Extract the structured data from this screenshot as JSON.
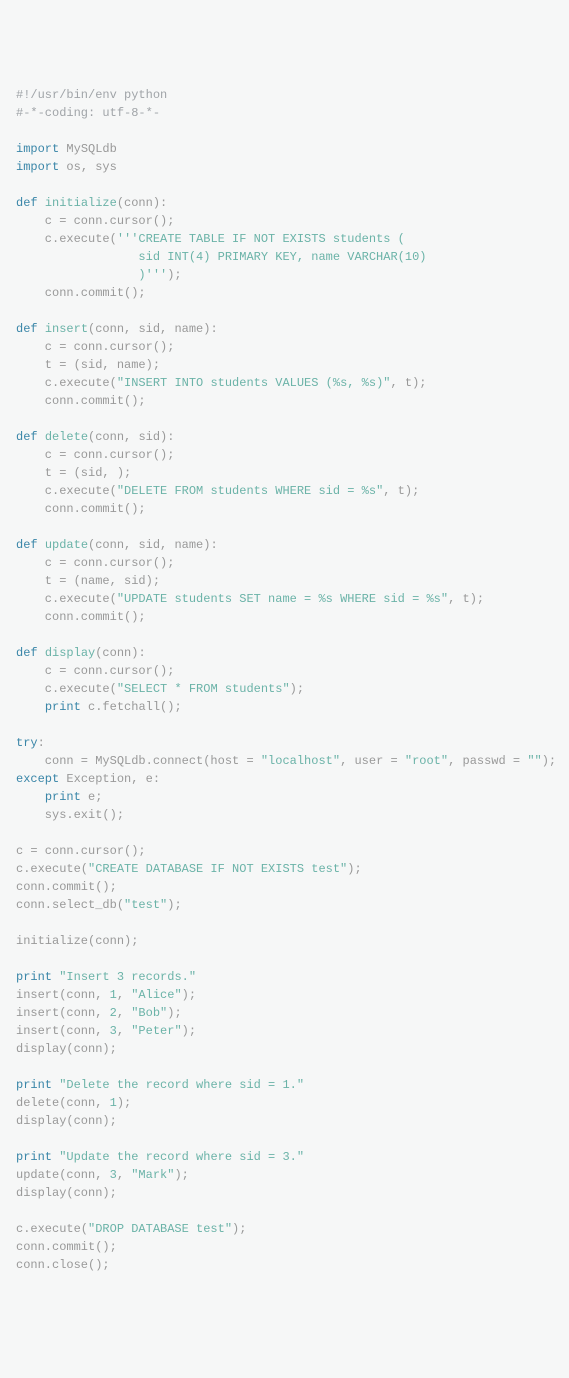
{
  "code": {
    "lines": [
      [
        [
          "com",
          "#!/usr/bin/env python"
        ]
      ],
      [
        [
          "com",
          "#-*-coding: utf-8-*-"
        ]
      ],
      [],
      [
        [
          "kw",
          "import"
        ],
        [
          "id",
          " MySQLdb"
        ]
      ],
      [
        [
          "kw",
          "import"
        ],
        [
          "id",
          " os, sys"
        ]
      ],
      [],
      [
        [
          "kw",
          "def"
        ],
        [
          "id",
          " "
        ],
        [
          "fn",
          "initialize"
        ],
        [
          "id",
          "(conn):"
        ]
      ],
      [
        [
          "id",
          "    c = conn.cursor();"
        ]
      ],
      [
        [
          "id",
          "    c.execute("
        ],
        [
          "str",
          "'''CREATE TABLE IF NOT EXISTS students ("
        ]
      ],
      [
        [
          "str",
          "                 sid INT(4) PRIMARY KEY, name VARCHAR(10)"
        ]
      ],
      [
        [
          "str",
          "                 )'''"
        ],
        [
          "id",
          ");"
        ]
      ],
      [
        [
          "id",
          "    conn.commit();"
        ]
      ],
      [],
      [
        [
          "kw",
          "def"
        ],
        [
          "id",
          " "
        ],
        [
          "fn",
          "insert"
        ],
        [
          "id",
          "(conn, sid, name):"
        ]
      ],
      [
        [
          "id",
          "    c = conn.cursor();"
        ]
      ],
      [
        [
          "id",
          "    t = (sid, name);"
        ]
      ],
      [
        [
          "id",
          "    c.execute("
        ],
        [
          "str",
          "\"INSERT INTO students VALUES (%s, %s)\""
        ],
        [
          "id",
          ", t);"
        ]
      ],
      [
        [
          "id",
          "    conn.commit();"
        ]
      ],
      [],
      [
        [
          "kw",
          "def"
        ],
        [
          "id",
          " "
        ],
        [
          "fn",
          "delete"
        ],
        [
          "id",
          "(conn, sid):"
        ]
      ],
      [
        [
          "id",
          "    c = conn.cursor();"
        ]
      ],
      [
        [
          "id",
          "    t = (sid, );"
        ]
      ],
      [
        [
          "id",
          "    c.execute("
        ],
        [
          "str",
          "\"DELETE FROM students WHERE sid = %s\""
        ],
        [
          "id",
          ", t);"
        ]
      ],
      [
        [
          "id",
          "    conn.commit();"
        ]
      ],
      [],
      [
        [
          "kw",
          "def"
        ],
        [
          "id",
          " "
        ],
        [
          "fn",
          "update"
        ],
        [
          "id",
          "(conn, sid, name):"
        ]
      ],
      [
        [
          "id",
          "    c = conn.cursor();"
        ]
      ],
      [
        [
          "id",
          "    t = (name, sid);"
        ]
      ],
      [
        [
          "id",
          "    c.execute("
        ],
        [
          "str",
          "\"UPDATE students SET name = %s WHERE sid = %s\""
        ],
        [
          "id",
          ", t);"
        ]
      ],
      [
        [
          "id",
          "    conn.commit();"
        ]
      ],
      [],
      [
        [
          "kw",
          "def"
        ],
        [
          "id",
          " "
        ],
        [
          "fn",
          "display"
        ],
        [
          "id",
          "(conn):"
        ]
      ],
      [
        [
          "id",
          "    c = conn.cursor();"
        ]
      ],
      [
        [
          "id",
          "    c.execute("
        ],
        [
          "str",
          "\"SELECT * FROM students\""
        ],
        [
          "id",
          ");"
        ]
      ],
      [
        [
          "id",
          "    "
        ],
        [
          "kw",
          "print"
        ],
        [
          "id",
          " c.fetchall();"
        ]
      ],
      [],
      [
        [
          "kw",
          "try"
        ],
        [
          "id",
          ":"
        ]
      ],
      [
        [
          "id",
          "    conn = MySQLdb.connect(host = "
        ],
        [
          "str",
          "\"localhost\""
        ],
        [
          "id",
          ", user = "
        ],
        [
          "str",
          "\"root\""
        ],
        [
          "id",
          ", passwd = "
        ],
        [
          "str",
          "\"\""
        ],
        [
          "id",
          ");"
        ]
      ],
      [
        [
          "kw",
          "except"
        ],
        [
          "id",
          " Exception, e:"
        ]
      ],
      [
        [
          "id",
          "    "
        ],
        [
          "kw",
          "print"
        ],
        [
          "id",
          " e;"
        ]
      ],
      [
        [
          "id",
          "    sys.exit();"
        ]
      ],
      [],
      [
        [
          "id",
          "c = conn.cursor();"
        ]
      ],
      [
        [
          "id",
          "c.execute("
        ],
        [
          "str",
          "\"CREATE DATABASE IF NOT EXISTS test\""
        ],
        [
          "id",
          ");"
        ]
      ],
      [
        [
          "id",
          "conn.commit();"
        ]
      ],
      [
        [
          "id",
          "conn.select_db("
        ],
        [
          "str",
          "\"test\""
        ],
        [
          "id",
          ");"
        ]
      ],
      [],
      [
        [
          "id",
          "initialize(conn);"
        ]
      ],
      [],
      [
        [
          "kw",
          "print"
        ],
        [
          "id",
          " "
        ],
        [
          "str",
          "\"Insert 3 records.\""
        ]
      ],
      [
        [
          "id",
          "insert(conn, "
        ],
        [
          "num",
          "1"
        ],
        [
          "id",
          ", "
        ],
        [
          "str",
          "\"Alice\""
        ],
        [
          "id",
          ");"
        ]
      ],
      [
        [
          "id",
          "insert(conn, "
        ],
        [
          "num",
          "2"
        ],
        [
          "id",
          ", "
        ],
        [
          "str",
          "\"Bob\""
        ],
        [
          "id",
          ");"
        ]
      ],
      [
        [
          "id",
          "insert(conn, "
        ],
        [
          "num",
          "3"
        ],
        [
          "id",
          ", "
        ],
        [
          "str",
          "\"Peter\""
        ],
        [
          "id",
          ");"
        ]
      ],
      [
        [
          "id",
          "display(conn);"
        ]
      ],
      [],
      [
        [
          "kw",
          "print"
        ],
        [
          "id",
          " "
        ],
        [
          "str",
          "\"Delete the record where sid = 1.\""
        ]
      ],
      [
        [
          "id",
          "delete(conn, "
        ],
        [
          "num",
          "1"
        ],
        [
          "id",
          ");"
        ]
      ],
      [
        [
          "id",
          "display(conn);"
        ]
      ],
      [],
      [
        [
          "kw",
          "print"
        ],
        [
          "id",
          " "
        ],
        [
          "str",
          "\"Update the record where sid = 3.\""
        ]
      ],
      [
        [
          "id",
          "update(conn, "
        ],
        [
          "num",
          "3"
        ],
        [
          "id",
          ", "
        ],
        [
          "str",
          "\"Mark\""
        ],
        [
          "id",
          ");"
        ]
      ],
      [
        [
          "id",
          "display(conn);"
        ]
      ],
      [],
      [
        [
          "id",
          "c.execute("
        ],
        [
          "str",
          "\"DROP DATABASE test\""
        ],
        [
          "id",
          ");"
        ]
      ],
      [
        [
          "id",
          "conn.commit();"
        ]
      ],
      [
        [
          "id",
          "conn.close();"
        ]
      ]
    ]
  }
}
